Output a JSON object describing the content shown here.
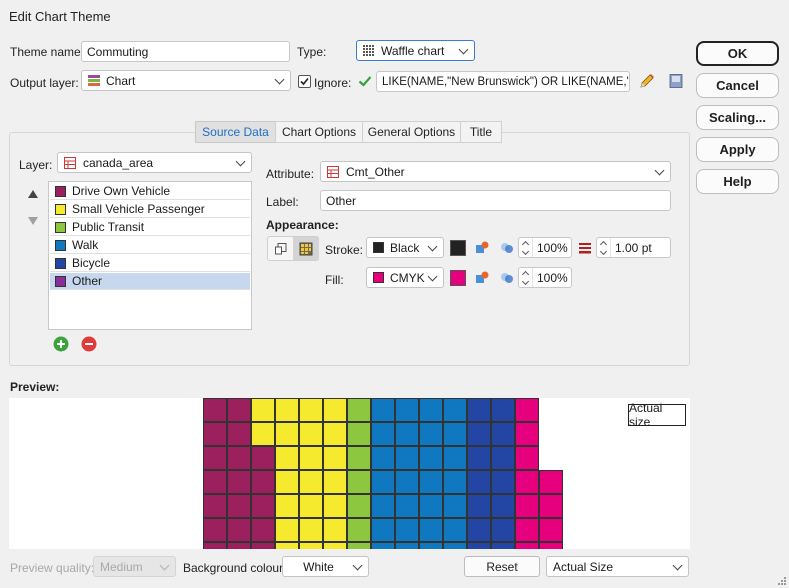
{
  "window": {
    "title": "Edit Chart Theme"
  },
  "theme_name": {
    "label": "Theme name:",
    "value": "Commuting"
  },
  "type": {
    "label": "Type:",
    "value": "Waffle chart"
  },
  "output_layer": {
    "label": "Output layer:",
    "value": "Chart"
  },
  "ignore": {
    "label": "Ignore:",
    "checked": true,
    "expression": "LIKE(NAME,\"New Brunswick\") OR LIKE(NAME,\"Nova"
  },
  "buttons": {
    "ok": "OK",
    "cancel": "Cancel",
    "scaling": "Scaling...",
    "apply": "Apply",
    "help": "Help"
  },
  "tabs": [
    {
      "label": "Source Data",
      "active": true
    },
    {
      "label": "Chart Options",
      "active": false
    },
    {
      "label": "General Options",
      "active": false
    },
    {
      "label": "Title",
      "active": false
    }
  ],
  "layer": {
    "label": "Layer:",
    "value": "canada_area"
  },
  "items": [
    {
      "label": "Drive Own Vehicle",
      "color": "#9c1f5e"
    },
    {
      "label": "Small Vehicle Passenger",
      "color": "#f5ea2e"
    },
    {
      "label": "Public Transit",
      "color": "#8dc63f"
    },
    {
      "label": "Walk",
      "color": "#1078c0"
    },
    {
      "label": "Bicycle",
      "color": "#2346a4"
    },
    {
      "label": "Other",
      "color": "#8a2c9a",
      "selected": true
    }
  ],
  "attribute": {
    "label": "Attribute:",
    "value": "Cmt_Other"
  },
  "item_label": {
    "label": "Label:",
    "value": "Other"
  },
  "appearance": {
    "title": "Appearance:",
    "stroke": {
      "label": "Stroke:",
      "value": "Black",
      "color": "#222222",
      "opacity": "100%",
      "width": "1.00 pt"
    },
    "fill": {
      "label": "Fill:",
      "value": "CMYK",
      "color": "#e6007e",
      "opacity": "100%"
    }
  },
  "preview": {
    "title": "Preview:",
    "actual_size_label": "Actual size",
    "colors": [
      "#9c1f5e",
      "#f5ea2e",
      "#8dc63f",
      "#1078c0",
      "#2346a4",
      "#e6007e"
    ],
    "rows": [
      [
        0,
        0,
        1,
        1,
        1,
        1,
        2,
        3,
        3,
        3,
        3,
        4,
        4,
        5
      ],
      [
        0,
        0,
        1,
        1,
        1,
        1,
        2,
        3,
        3,
        3,
        3,
        4,
        4,
        5
      ],
      [
        0,
        0,
        0,
        1,
        1,
        1,
        2,
        3,
        3,
        3,
        3,
        4,
        4,
        5
      ],
      [
        0,
        0,
        0,
        1,
        1,
        1,
        2,
        3,
        3,
        3,
        3,
        4,
        4,
        5,
        5
      ],
      [
        0,
        0,
        0,
        1,
        1,
        1,
        2,
        3,
        3,
        3,
        3,
        4,
        4,
        5,
        5
      ],
      [
        0,
        0,
        0,
        1,
        1,
        1,
        2,
        3,
        3,
        3,
        3,
        4,
        4,
        5,
        5
      ],
      [
        0,
        0,
        0,
        1,
        1,
        1,
        2,
        3,
        3,
        3,
        3,
        4,
        4,
        5,
        5
      ]
    ]
  },
  "bottom": {
    "quality_label": "Preview quality:",
    "quality_value": "Medium",
    "background_label": "Background colour:",
    "background_value": "White",
    "reset": "Reset",
    "size_value": "Actual Size"
  }
}
